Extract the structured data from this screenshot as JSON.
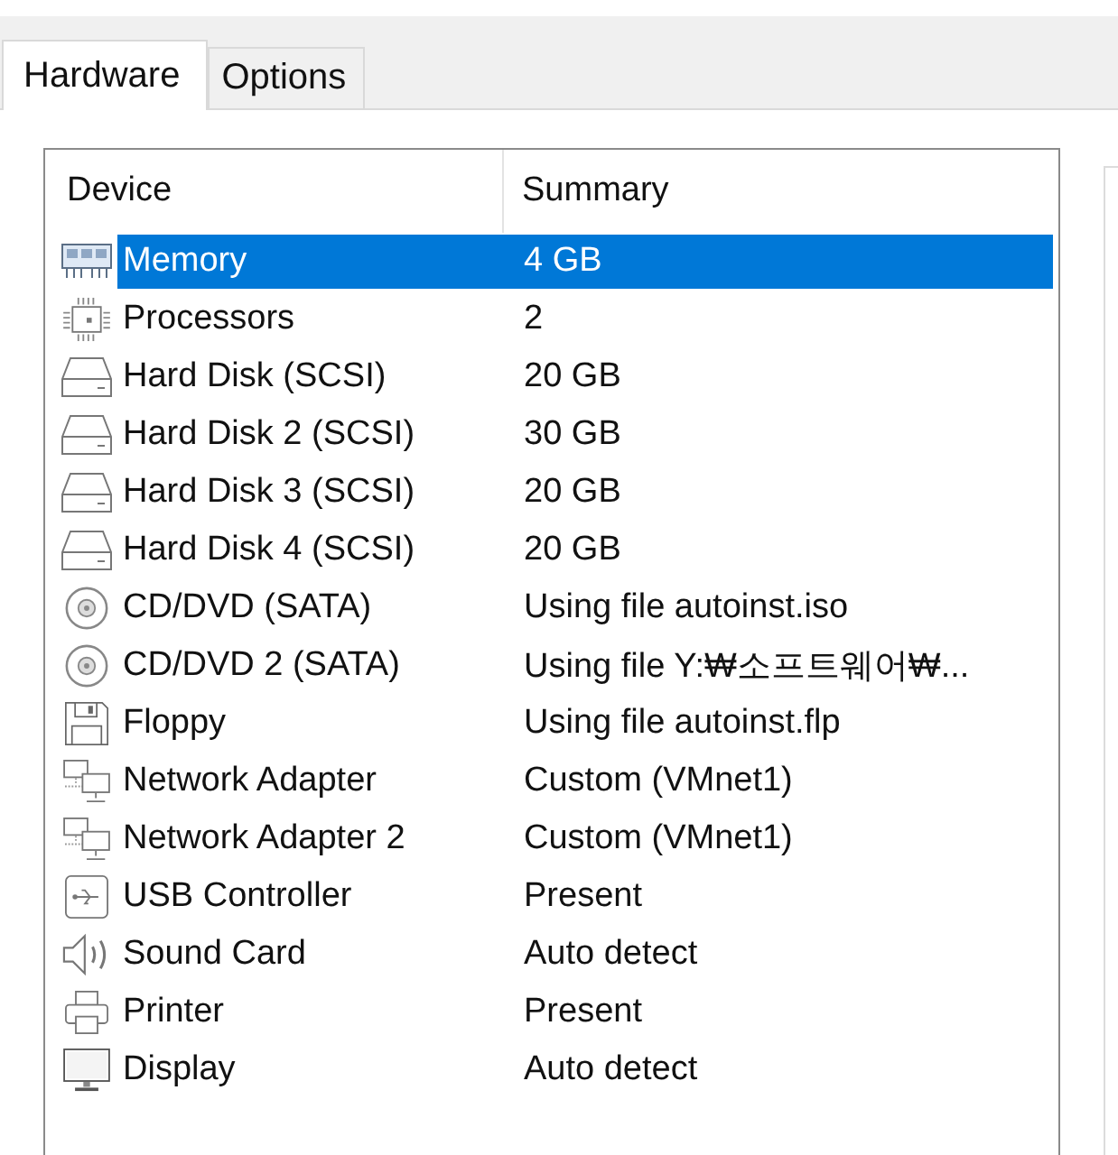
{
  "tabs": [
    {
      "label": "Hardware",
      "selected": true
    },
    {
      "label": "Options",
      "selected": false
    }
  ],
  "table": {
    "columns": [
      "Device",
      "Summary"
    ],
    "rows": [
      {
        "kind": "memory",
        "device": "Memory",
        "summary": "4 GB",
        "selected": true
      },
      {
        "kind": "processor",
        "device": "Processors",
        "summary": "2",
        "selected": false
      },
      {
        "kind": "disk",
        "device": "Hard Disk (SCSI)",
        "summary": "20 GB",
        "selected": false
      },
      {
        "kind": "disk",
        "device": "Hard Disk 2 (SCSI)",
        "summary": "30 GB",
        "selected": false
      },
      {
        "kind": "disk",
        "device": "Hard Disk 3 (SCSI)",
        "summary": "20 GB",
        "selected": false
      },
      {
        "kind": "disk",
        "device": "Hard Disk 4 (SCSI)",
        "summary": "20 GB",
        "selected": false
      },
      {
        "kind": "cdrom",
        "device": "CD/DVD (SATA)",
        "summary": "Using file autoinst.iso",
        "selected": false
      },
      {
        "kind": "cdrom",
        "device": "CD/DVD 2 (SATA)",
        "summary": "Using file Y:₩소프트웨어₩...",
        "selected": false
      },
      {
        "kind": "floppy",
        "device": "Floppy",
        "summary": "Using file autoinst.flp",
        "selected": false
      },
      {
        "kind": "network",
        "device": "Network Adapter",
        "summary": "Custom (VMnet1)",
        "selected": false
      },
      {
        "kind": "network",
        "device": "Network Adapter 2",
        "summary": "Custom (VMnet1)",
        "selected": false
      },
      {
        "kind": "usb",
        "device": "USB Controller",
        "summary": "Present",
        "selected": false
      },
      {
        "kind": "sound",
        "device": "Sound Card",
        "summary": "Auto detect",
        "selected": false
      },
      {
        "kind": "printer",
        "device": "Printer",
        "summary": "Present",
        "selected": false
      },
      {
        "kind": "display",
        "device": "Display",
        "summary": "Auto detect",
        "selected": false
      }
    ]
  }
}
